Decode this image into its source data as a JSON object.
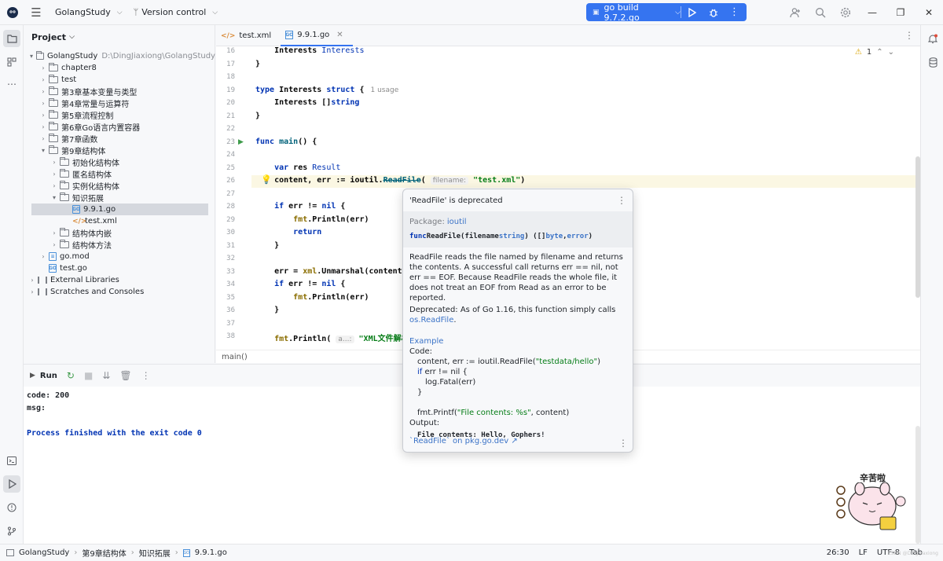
{
  "titlebar": {
    "project": "GolangStudy",
    "vcs": "Version control",
    "run_config": "go build 9.7.2.go"
  },
  "project_panel": {
    "title": "Project",
    "root": {
      "name": "GolangStudy",
      "path": "D:\\DingJiaxiong\\GolangStudy"
    },
    "items": [
      {
        "label": "chapter8"
      },
      {
        "label": "test"
      },
      {
        "label": "第3章基本变量与类型"
      },
      {
        "label": "第4章常量与运算符"
      },
      {
        "label": "第5章流程控制"
      },
      {
        "label": "第6章Go语言内置容器"
      },
      {
        "label": "第7章函数"
      },
      {
        "label": "第9章结构体"
      },
      {
        "label": "初始化结构体"
      },
      {
        "label": "匿名结构体"
      },
      {
        "label": "实例化结构体"
      },
      {
        "label": "知识拓展"
      },
      {
        "label": "9.9.1.go"
      },
      {
        "label": "test.xml"
      },
      {
        "label": "结构体内嵌"
      },
      {
        "label": "结构体方法"
      },
      {
        "label": "go.mod"
      },
      {
        "label": "test.go"
      },
      {
        "label": "External Libraries"
      },
      {
        "label": "Scratches and Consoles"
      }
    ]
  },
  "tabs": [
    {
      "label": "test.xml"
    },
    {
      "label": "9.9.1.go"
    }
  ],
  "editor": {
    "warnings": "1",
    "line_numbers": [
      "16",
      "17",
      "18",
      "19",
      "20",
      "21",
      "22",
      "23",
      "24",
      "25",
      "26",
      "27",
      "28",
      "29",
      "30",
      "31",
      "32",
      "33",
      "34",
      "35",
      "36",
      "37",
      "38"
    ],
    "code": {
      "l16a": "    Interests ",
      "l16b": "Interests",
      "l17": "}",
      "l19a": "type ",
      "l19b": "Interests ",
      "l19c": "struct",
      "l19d": " {",
      "l19usage": "1 usage",
      "l20a": "    Interests []",
      "l20b": "string",
      "l21": "}",
      "l23a": "func ",
      "l23b": "main",
      "l23c": "() {",
      "l25a": "    var ",
      "l25b": "res ",
      "l25c": "Result",
      "l26a": "    content, err := ",
      "l26b": "ioutil",
      "l26c": ".",
      "l26d": "ReadFile",
      "l26e": "( ",
      "l26hint": "filename:",
      "l26f": " \"test.xml\"",
      "l26g": ")",
      "l28a": "    if ",
      "l28b": "err != ",
      "l28c": "nil",
      "l28d": " {",
      "l29a": "        fmt",
      "l29b": ".Println(err)",
      "l30": "        return",
      "l31": "    }",
      "l33a": "    err = ",
      "l33b": "xml",
      "l33c": ".Unmarshal(content",
      "l34a": "    if ",
      "l34b": "err != ",
      "l34c": "nil",
      "l34d": " {",
      "l35a": "        fmt",
      "l35b": ".Println(err)",
      "l36": "    }",
      "l38a": "    fmt",
      "l38b": ".Println( ",
      "l38hint": "a...:",
      "l38c": " \"XML文件解析"
    },
    "breadcrumb": "main()"
  },
  "popup": {
    "title": "'ReadFile' is deprecated",
    "package_label": "Package:",
    "package_name": "ioutil",
    "sig_func": "func ",
    "sig_name": "ReadFile",
    "sig_params_a": "(filename ",
    "sig_string": "string",
    "sig_params_b": ") ([]",
    "sig_byte": "byte",
    "sig_params_c": ", ",
    "sig_error": "error",
    "sig_params_d": ")",
    "description": "ReadFile reads the file named by filename and returns the contents. A successful call returns err == nil, not err == EOF. Because ReadFile reads the whole file, it does not treat an EOF from Read as an error to be reported.",
    "deprecated": "Deprecated: As of Go 1.16, this function simply calls",
    "deprecated_link": "os.ReadFile",
    "deprecated_end": ".",
    "example_label": "Example",
    "code_label": "Code:",
    "ex1a": "content, err := ioutil.ReadFile(",
    "ex1b": "\"testdata/hello\"",
    "ex1c": ")",
    "ex2a": "if",
    "ex2b": " err != nil {",
    "ex3": "log.Fatal(err)",
    "ex4": "}",
    "ex5a": "fmt.Printf(",
    "ex5b": "\"File contents: %s\"",
    "ex5c": ", content)",
    "output_label": "Output:",
    "output_value": "File contents: Hello, Gophers!",
    "footer_link": "`ReadFile` on pkg.go.dev ↗"
  },
  "run_panel": {
    "tab_label": "Run",
    "console": {
      "line1": "code:  200",
      "line2": "msg:",
      "line3": "Process finished with the exit code 0"
    }
  },
  "sticker": {
    "text": "辛苦啦"
  },
  "status_bar": {
    "crumbs": [
      "GolangStudy",
      "第9章结构体",
      "知识拓展",
      "9.9.1.go"
    ],
    "position": "26:30",
    "line_ending": "LF",
    "encoding": "UTF-8",
    "indent": "Tab"
  },
  "watermark": "CSDN @Ding Jiaxiong",
  "colors": {
    "accent": "#3574f0",
    "keyword": "#0033b3",
    "string": "#067d17",
    "current_line": "#fbf7e3"
  }
}
